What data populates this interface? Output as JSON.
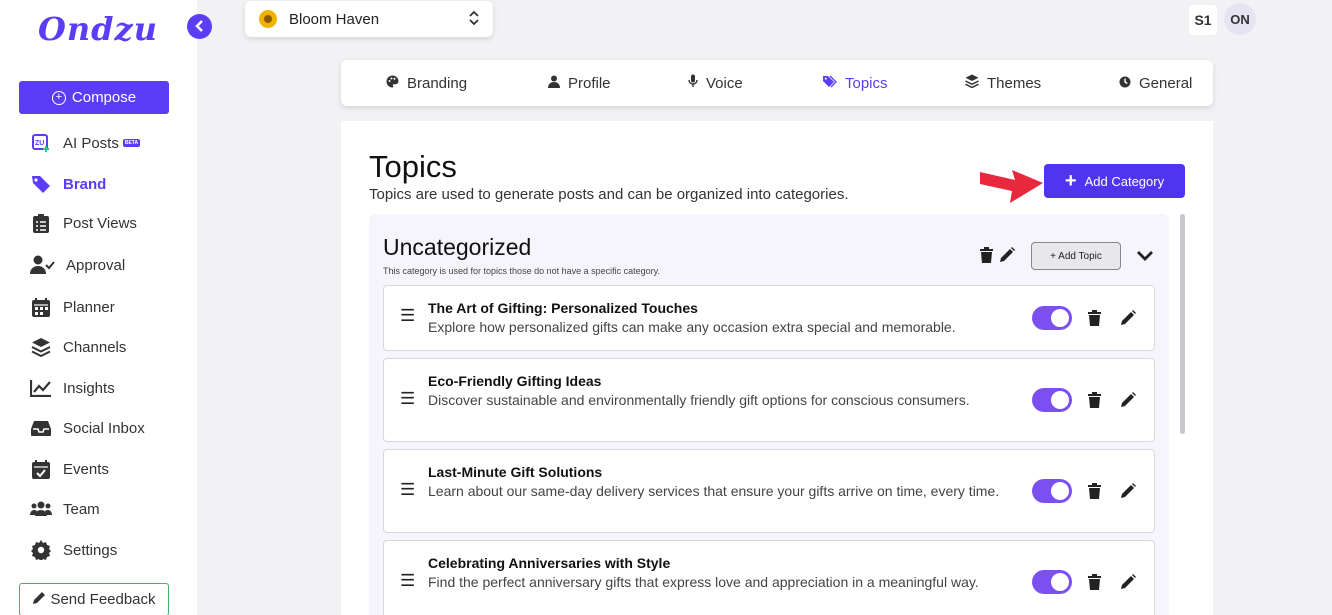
{
  "app": {
    "logo_text": "Ondzu"
  },
  "sidebar": {
    "compose_label": "Compose",
    "beta_badge": "BETA",
    "items": [
      {
        "label": "AI Posts",
        "icon": "ai-posts-icon"
      },
      {
        "label": "Brand",
        "icon": "tag-icon",
        "active": true
      },
      {
        "label": "Post Views",
        "icon": "clipboard-icon"
      },
      {
        "label": "Approval",
        "icon": "user-check-icon"
      },
      {
        "label": "Planner",
        "icon": "calendar-icon"
      },
      {
        "label": "Channels",
        "icon": "layers-icon"
      },
      {
        "label": "Insights",
        "icon": "chart-line-icon"
      },
      {
        "label": "Social Inbox",
        "icon": "inbox-icon"
      },
      {
        "label": "Events",
        "icon": "calendar-check-icon"
      },
      {
        "label": "Team",
        "icon": "users-icon"
      },
      {
        "label": "Settings",
        "icon": "gear-icon"
      }
    ],
    "feedback_label": "Send Feedback"
  },
  "header": {
    "brand_name": "Bloom Haven",
    "user_s1": "S1",
    "user_initials": "ON"
  },
  "tabs": [
    {
      "label": "Branding",
      "icon": "palette-icon"
    },
    {
      "label": "Profile",
      "icon": "user-icon"
    },
    {
      "label": "Voice",
      "icon": "microphone-icon"
    },
    {
      "label": "Topics",
      "icon": "tags-icon",
      "active": true
    },
    {
      "label": "Themes",
      "icon": "layers-icon"
    },
    {
      "label": "General",
      "icon": "clock-icon"
    }
  ],
  "main": {
    "title": "Topics",
    "subtitle": "Topics are used to generate posts and can be organized into categories.",
    "add_category_label": "Add Category",
    "category": {
      "name": "Uncategorized",
      "description": "This category is used for topics those do not have a specific category.",
      "add_topic_label": "+ Add Topic",
      "topics": [
        {
          "title": "The Art of Gifting: Personalized Touches",
          "description": "Explore how personalized gifts can make any occasion extra special and memorable.",
          "enabled": true
        },
        {
          "title": "Eco-Friendly Gifting Ideas",
          "description": "Discover sustainable and environmentally friendly gift options for conscious consumers.",
          "enabled": true
        },
        {
          "title": "Last-Minute Gift Solutions",
          "description": "Learn about our same-day delivery services that ensure your gifts arrive on time, every time.",
          "enabled": true
        },
        {
          "title": "Celebrating Anniversaries with Style",
          "description": "Find the perfect anniversary gifts that express love and appreciation in a meaningful way.",
          "enabled": true
        }
      ]
    }
  },
  "colors": {
    "accent": "#5b3df5",
    "toggle_on": "#7b4ff0",
    "feedback_border": "#43b36a",
    "annotation_arrow": "#e8283c"
  }
}
